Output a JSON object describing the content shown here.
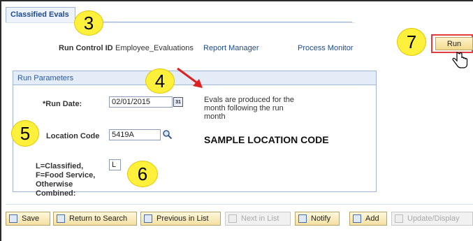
{
  "tab": {
    "label": "Classified Evals"
  },
  "run_control": {
    "label": "Run Control ID",
    "value": "Employee_Evaluations",
    "report_manager": "Report Manager",
    "process_monitor": "Process Monitor"
  },
  "run_button": {
    "label": "Run"
  },
  "run_parameters": {
    "title": "Run Parameters",
    "run_date_label": "*Run Date:",
    "run_date_value": "02/01/2015",
    "calendar_icon_text": "31",
    "location_code_label": "Location Code",
    "location_code_value": "5419A",
    "type_label": "L=Classified, F=Food Service, Otherwise Combined:",
    "type_value": "L",
    "note": "Evals are produced for the month following the run month",
    "sample_text": "SAMPLE LOCATION CODE"
  },
  "callouts": {
    "c3": "3",
    "c4": "4",
    "c5": "5",
    "c6": "6",
    "c7": "7"
  },
  "toolbar": {
    "save": "Save",
    "return_to_search": "Return to Search",
    "previous_in_list": "Previous in List",
    "next_in_list": "Next in List",
    "notify": "Notify",
    "add": "Add",
    "update_display": "Update/Display"
  },
  "colors": {
    "callout": "#fff03c",
    "run_highlight": "#e33c3c",
    "link": "#1d4a8c",
    "arrow": "#e02020"
  }
}
